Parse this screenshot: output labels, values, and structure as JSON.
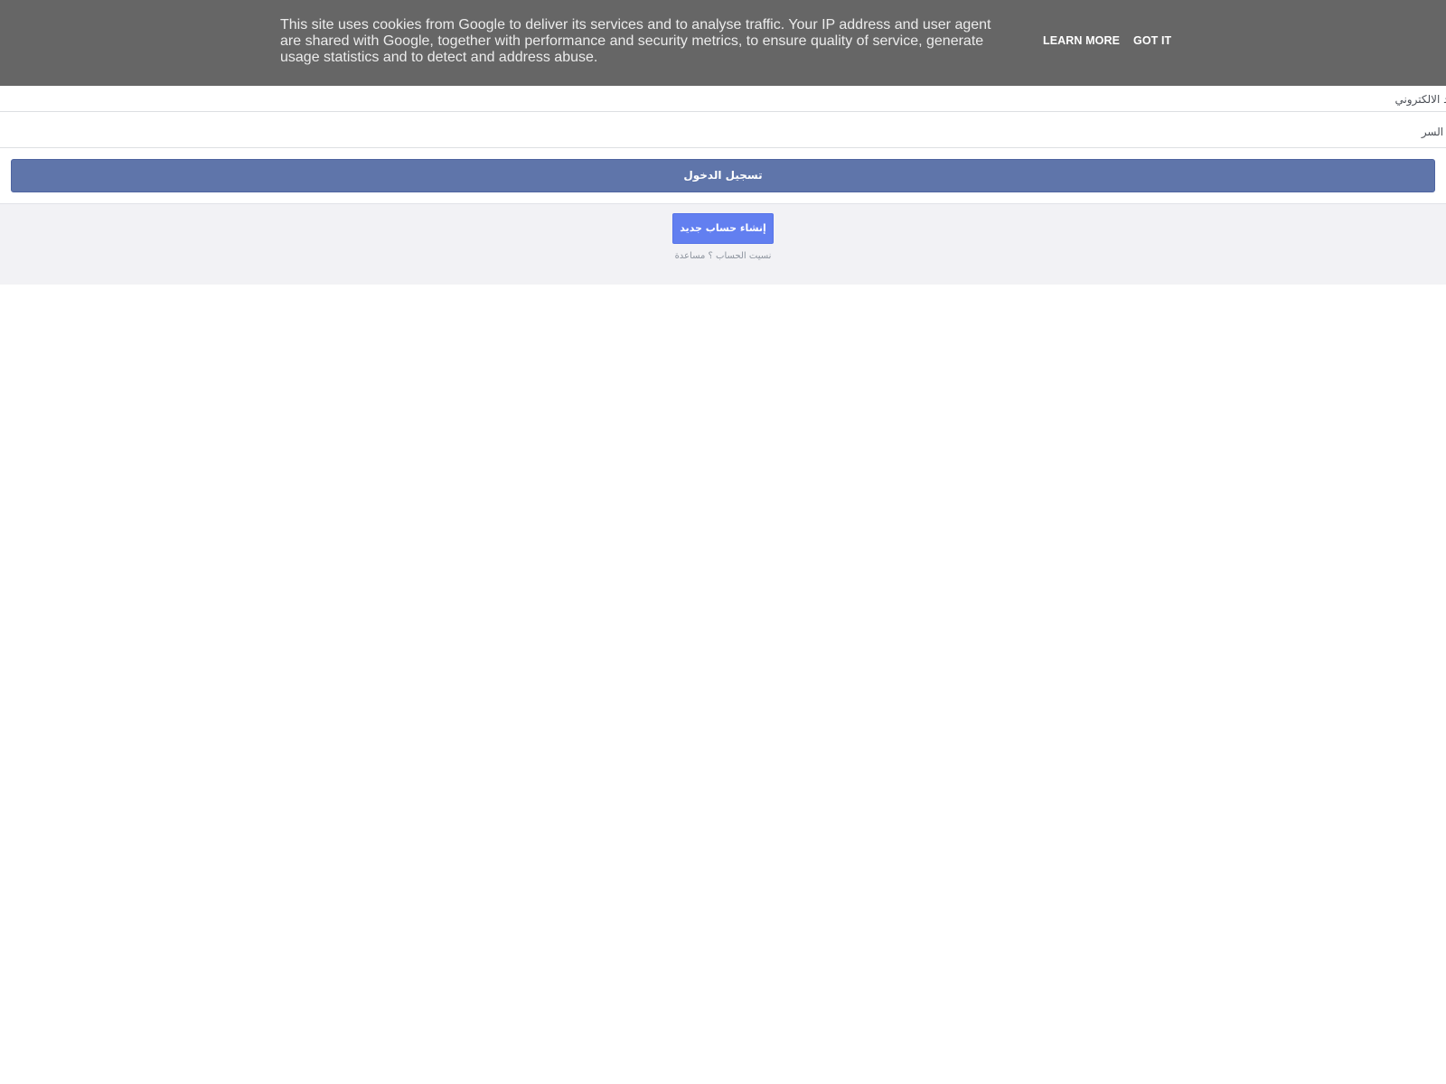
{
  "cookie_banner": {
    "message": "This site uses cookies from Google to deliver its services and to analyse traffic. Your IP address and user agent are shared with Google, together with performance and security metrics, to ensure quality of service, generate usage statistics and to detect and address abuse.",
    "learn_more_label": "LEARN MORE",
    "got_it_label": "GOT IT"
  },
  "login_form": {
    "email_placeholder": "البريد الالكتروني",
    "password_placeholder": "كلمة السر",
    "login_label": "تسجيل الدخول"
  },
  "footer_actions": {
    "signup_label": "إنشاء حساب جديد",
    "forgot_account_label": "نسيت الحساب",
    "separator": "؟",
    "help_label": "مساعدة"
  },
  "colors": {
    "banner_bg": "#666666",
    "login_button": "#5f75aa",
    "signup_button": "#627ff0",
    "bottom_bg": "#f2f2f5"
  }
}
